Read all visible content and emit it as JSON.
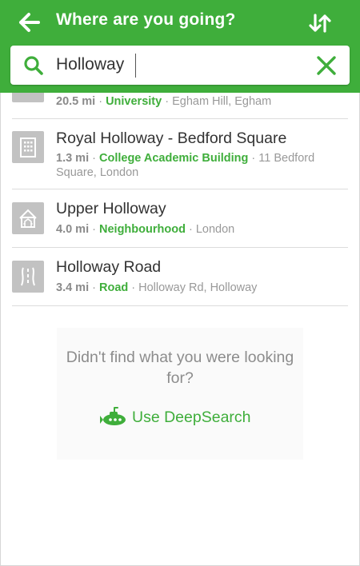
{
  "header": {
    "title": "Where are you going?"
  },
  "search": {
    "value": "Holloway"
  },
  "results": [
    {
      "title": "",
      "distance": "20.5 mi",
      "category": "University",
      "address": "Egham Hill, Egham"
    },
    {
      "title": "Royal Holloway - Bedford Square",
      "distance": "1.3 mi",
      "category": "College Academic Building",
      "address": "11 Bedford Square, London"
    },
    {
      "title": "Upper Holloway",
      "distance": "4.0 mi",
      "category": "Neighbourhood",
      "address": "London"
    },
    {
      "title": "Holloway Road",
      "distance": "3.4 mi",
      "category": "Road",
      "address": "Holloway Rd, Holloway"
    }
  ],
  "deepsearch": {
    "prompt": "Didn't find what you were looking for?",
    "button_label": "Use DeepSearch"
  },
  "colors": {
    "brand_green": "#3fae3b",
    "icon_bg": "#c2c2c2"
  }
}
